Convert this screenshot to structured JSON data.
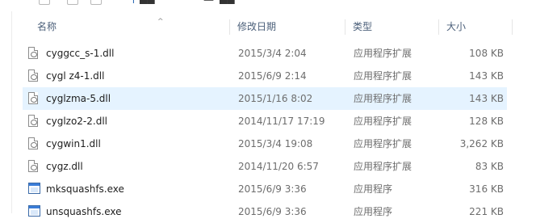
{
  "header": {
    "name": "名称",
    "date_modified": "修改日期",
    "type": "类型",
    "size": "大小"
  },
  "files": [
    {
      "name": "cyggcc_s-1.dll",
      "date": "2015/3/4 2:04",
      "type": "应用程序扩展",
      "size": "108 KB",
      "icon": "dll-file-icon"
    },
    {
      "name": "cygl z4-1.dll",
      "date": "2015/6/9 2:14",
      "type": "应用程序扩展",
      "size": "143 KB",
      "icon": "dll-file-icon"
    },
    {
      "name": "cyglzma-5.dll",
      "date": "2015/1/16 8:02",
      "type": "应用程序扩展",
      "size": "143 KB",
      "icon": "dll-file-icon"
    },
    {
      "name": "cyglzo2-2.dll",
      "date": "2014/11/17 17:19",
      "type": "应用程序扩展",
      "size": "128 KB",
      "icon": "dll-file-icon"
    },
    {
      "name": "cygwin1.dll",
      "date": "2015/3/4 19:08",
      "type": "应用程序扩展",
      "size": "3,262 KB",
      "icon": "dll-file-icon"
    },
    {
      "name": "cygz.dll",
      "date": "2014/11/20 6:57",
      "type": "应用程序扩展",
      "size": "83 KB",
      "icon": "dll-file-icon"
    },
    {
      "name": "mksquashfs.exe",
      "date": "2015/6/9 3:36",
      "type": "应用程序",
      "size": "316 KB",
      "icon": "exe-file-icon"
    },
    {
      "name": "unsquashfs.exe",
      "date": "2015/6/9 3:36",
      "type": "应用程序",
      "size": "221 KB",
      "icon": "exe-file-icon"
    }
  ],
  "colors": {
    "hover_row": "#e5f3ff",
    "header_text": "#4c607a",
    "secondary_text": "#6d6d6d"
  }
}
